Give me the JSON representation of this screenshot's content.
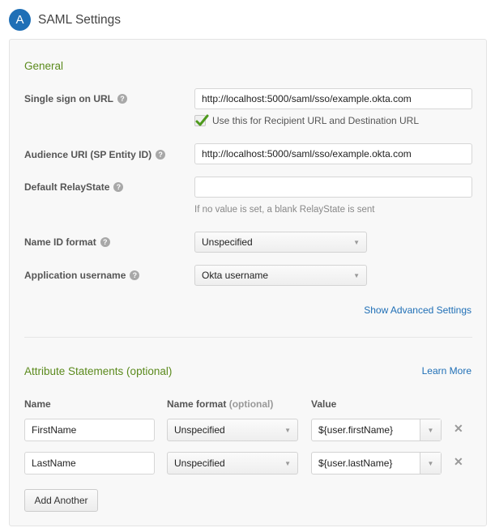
{
  "header": {
    "badge": "A",
    "title": "SAML Settings"
  },
  "general": {
    "title": "General",
    "sso_url": {
      "label": "Single sign on URL",
      "value": "http://localhost:5000/saml/sso/example.okta.com",
      "checkbox_label": "Use this for Recipient URL and Destination URL",
      "checkbox_checked": true
    },
    "audience_uri": {
      "label": "Audience URI (SP Entity ID)",
      "value": "http://localhost:5000/saml/sso/example.okta.com"
    },
    "relay_state": {
      "label": "Default RelayState",
      "value": "",
      "hint": "If no value is set, a blank RelayState is sent"
    },
    "name_id_format": {
      "label": "Name ID format",
      "selected": "Unspecified"
    },
    "app_username": {
      "label": "Application username",
      "selected": "Okta username"
    },
    "advanced_link": "Show Advanced Settings"
  },
  "attributes": {
    "title": "Attribute Statements (optional)",
    "learn_more": "Learn More",
    "columns": {
      "name": "Name",
      "name_format": "Name format",
      "name_format_optional": "(optional)",
      "value": "Value"
    },
    "rows": [
      {
        "name": "FirstName",
        "format": "Unspecified",
        "value": "${user.firstName}"
      },
      {
        "name": "LastName",
        "format": "Unspecified",
        "value": "${user.lastName}"
      }
    ],
    "add_button": "Add Another"
  },
  "icons": {
    "help": "?",
    "caret": "▼",
    "remove": "✕"
  }
}
